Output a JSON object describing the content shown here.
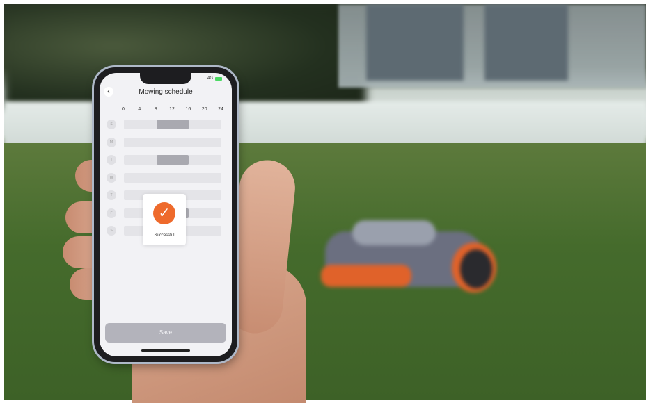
{
  "app": {
    "title": "Mowing schedule",
    "status_network": "4G",
    "back_icon": "chevron-left-icon"
  },
  "schedule": {
    "hour_ticks": [
      "0",
      "4",
      "8",
      "12",
      "16",
      "20",
      "24"
    ],
    "days": [
      {
        "label": "S",
        "slots": [
          [
            8,
            16
          ]
        ]
      },
      {
        "label": "M",
        "slots": []
      },
      {
        "label": "T",
        "slots": [
          [
            8,
            16
          ]
        ]
      },
      {
        "label": "W",
        "slots": []
      },
      {
        "label": "T",
        "slots": []
      },
      {
        "label": "F",
        "slots": [
          [
            8,
            16
          ]
        ]
      },
      {
        "label": "S",
        "slots": []
      }
    ]
  },
  "toast": {
    "label": "Successful",
    "icon": "checkmark-icon",
    "accent_color": "#ee6a2c"
  },
  "footer": {
    "save_label": "Save"
  }
}
